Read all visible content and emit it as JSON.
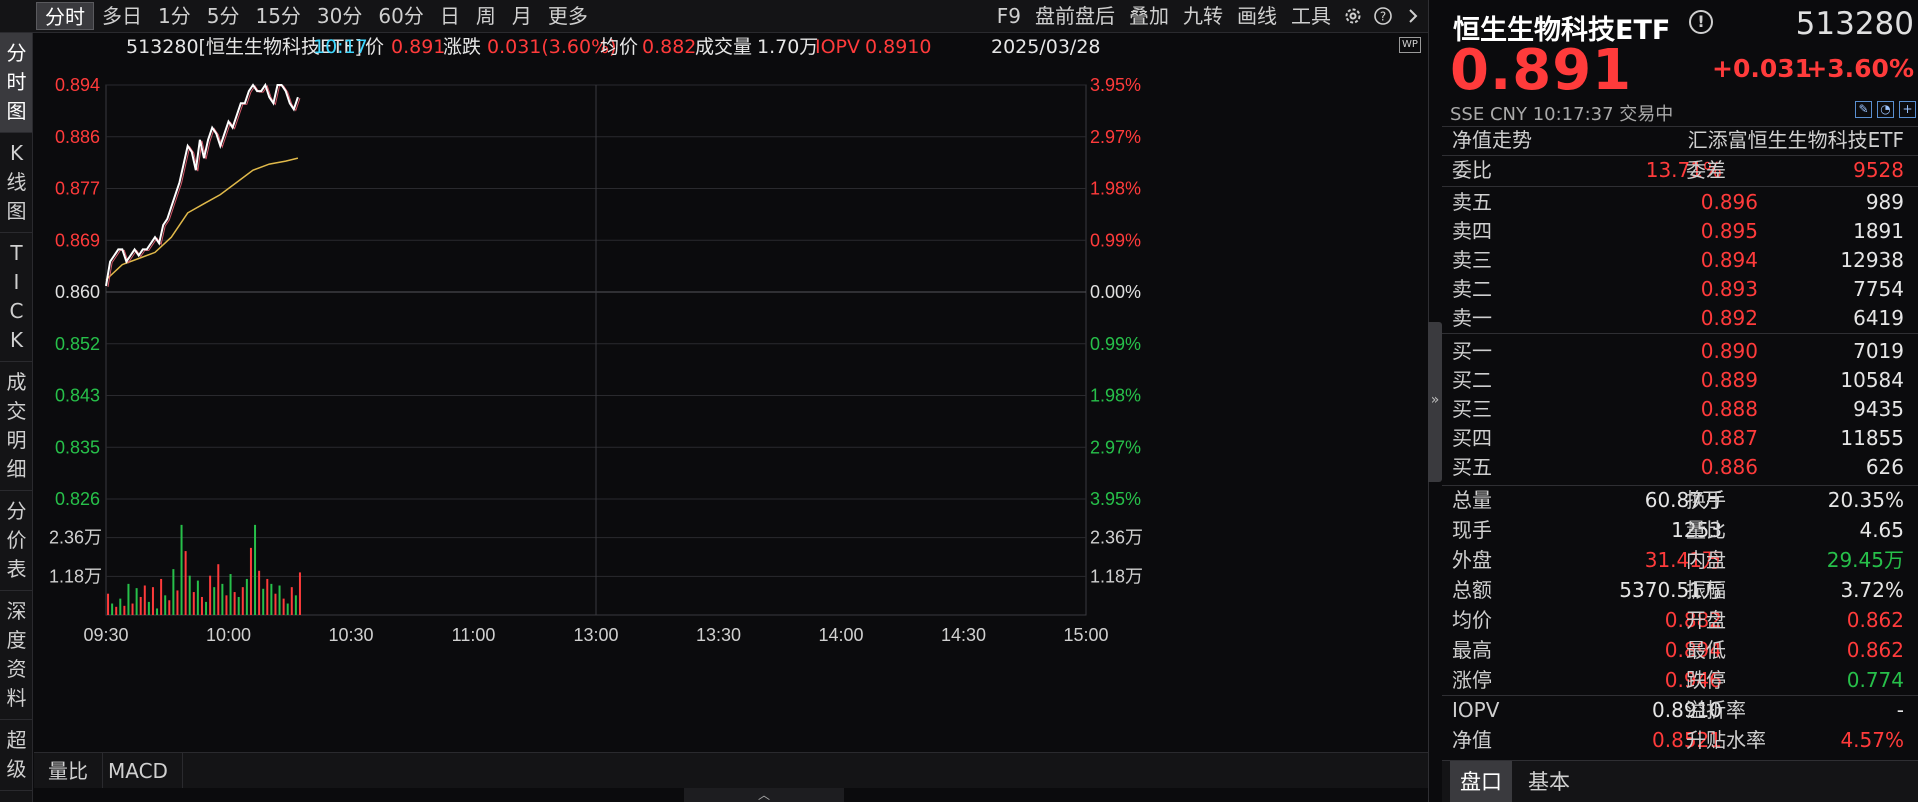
{
  "toolbar": {
    "periods": [
      "分时",
      "多日",
      "1分",
      "5分",
      "15分",
      "30分",
      "60分",
      "日",
      "周",
      "月",
      "更多"
    ],
    "tools": [
      "F9",
      "盘前盘后",
      "叠加",
      "九转",
      "画线",
      "工具"
    ],
    "icons": [
      "gear-icon",
      "help-icon",
      "chevron-right-icon"
    ]
  },
  "leftnav": [
    "分时图",
    "K线图",
    "TICK",
    "成交明细",
    "分价表",
    "深度资料",
    "超级"
  ],
  "chart": {
    "code_name": "513280[恒生生物科技ETF]",
    "time": "10:17",
    "price_label": "价",
    "price": "0.891",
    "change_label": "涨跌",
    "change": "0.031(3.60%)",
    "avg_label": "均价",
    "avg": "0.882",
    "volume_label": "成交量",
    "volume": "1.70万",
    "iopv_label": "IOPV",
    "iopv": "0.8910",
    "date": "2025/03/28",
    "wp_badge": "WP"
  },
  "chart_data": {
    "type": "line",
    "y_left_ticks": [
      "0.894",
      "0.886",
      "0.877",
      "0.869",
      "0.860",
      "0.852",
      "0.843",
      "0.835",
      "0.826"
    ],
    "y_right_ticks": [
      "3.95%",
      "2.97%",
      "1.98%",
      "0.99%",
      "0.00%",
      "0.99%",
      "1.98%",
      "2.97%",
      "3.95%"
    ],
    "x_ticks": [
      "09:30",
      "10:00",
      "10:30",
      "11:00",
      "13:00",
      "13:30",
      "14:00",
      "14:30",
      "15:00"
    ],
    "volume_ticks": [
      "2.36万",
      "1.18万"
    ],
    "ylim": [
      0.826,
      0.894
    ],
    "prev_close": 0.86,
    "colors": {
      "up": "#ff3b3b",
      "down": "#27c04a",
      "price_line": "#ffffff",
      "avg_line": "#e0b94a",
      "grid": "#2a2a2e"
    },
    "price_series": {
      "minutes": [
        0,
        1,
        2,
        3,
        4,
        5,
        6,
        7,
        8,
        9,
        10,
        11,
        12,
        13,
        14,
        15,
        16,
        17,
        18,
        19,
        20,
        21,
        22,
        23,
        24,
        25,
        26,
        27,
        28,
        29,
        30,
        31,
        32,
        33,
        34,
        35,
        36,
        37,
        38,
        39,
        40,
        41,
        42,
        43,
        44,
        45,
        46,
        47
      ],
      "values": [
        0.861,
        0.865,
        0.866,
        0.867,
        0.867,
        0.865,
        0.866,
        0.867,
        0.866,
        0.867,
        0.867,
        0.868,
        0.869,
        0.868,
        0.871,
        0.872,
        0.874,
        0.876,
        0.878,
        0.881,
        0.884,
        0.883,
        0.88,
        0.885,
        0.882,
        0.885,
        0.887,
        0.886,
        0.884,
        0.886,
        0.888,
        0.887,
        0.889,
        0.891,
        0.891,
        0.893,
        0.894,
        0.893,
        0.893,
        0.894,
        0.892,
        0.891,
        0.894,
        0.894,
        0.893,
        0.891,
        0.89,
        0.892
      ]
    },
    "avg_series": {
      "minutes": [
        0,
        4,
        8,
        12,
        16,
        20,
        24,
        28,
        32,
        36,
        40,
        44,
        47
      ],
      "values": [
        0.862,
        0.8645,
        0.8655,
        0.8665,
        0.869,
        0.873,
        0.8745,
        0.876,
        0.878,
        0.88,
        0.881,
        0.8815,
        0.882
      ]
    },
    "volume_series": {
      "unit": "万",
      "values": [
        0.65,
        0.35,
        0.25,
        0.5,
        0.28,
        0.95,
        0.35,
        0.82,
        0.55,
        0.9,
        0.4,
        0.85,
        0.2,
        1.1,
        0.6,
        0.45,
        1.4,
        0.75,
        2.75,
        1.95,
        1.2,
        0.7,
        1.05,
        0.55,
        0.4,
        1.2,
        0.85,
        1.55,
        0.95,
        0.6,
        1.25,
        0.7,
        0.55,
        0.85,
        1.1,
        2.05,
        2.75,
        1.35,
        0.8,
        1.1,
        0.95,
        0.65,
        0.9,
        0.5,
        0.35,
        0.85,
        0.6,
        1.3
      ],
      "up": [
        true,
        false,
        true,
        false,
        true,
        false,
        true,
        false,
        true,
        true,
        false,
        true,
        false,
        true,
        false,
        true,
        false,
        true,
        false,
        true,
        false,
        true,
        false,
        true,
        false,
        true,
        false,
        true,
        false,
        true,
        false,
        true,
        false,
        true,
        false,
        true,
        false,
        true,
        false,
        true,
        false,
        true,
        false,
        true,
        false,
        true,
        false,
        true
      ]
    }
  },
  "subtabs": [
    "量比",
    "MACD"
  ],
  "panel": {
    "name": "恒生生物科技ETF",
    "code": "513280",
    "price": "0.891",
    "change": "+0.031",
    "pct": "+3.60%",
    "status": "SSE  CNY  10:17:37  交易中",
    "nav_trend_label": "净值走势",
    "fund_name": "汇添富恒生生物科技ETF",
    "weibi_label": "委比",
    "weibi": "13.71%",
    "weicha_label": "委差",
    "weicha": "9528",
    "asks": [
      {
        "label": "卖五",
        "price": "0.896",
        "vol": "989"
      },
      {
        "label": "卖四",
        "price": "0.895",
        "vol": "1891"
      },
      {
        "label": "卖三",
        "price": "0.894",
        "vol": "12938"
      },
      {
        "label": "卖二",
        "price": "0.893",
        "vol": "7754"
      },
      {
        "label": "卖一",
        "price": "0.892",
        "vol": "6419"
      }
    ],
    "bids": [
      {
        "label": "买一",
        "price": "0.890",
        "vol": "7019"
      },
      {
        "label": "买二",
        "price": "0.889",
        "vol": "10584"
      },
      {
        "label": "买三",
        "price": "0.888",
        "vol": "9435"
      },
      {
        "label": "买四",
        "price": "0.887",
        "vol": "11855"
      },
      {
        "label": "买五",
        "price": "0.886",
        "vol": "626"
      }
    ],
    "stats": [
      {
        "l1": "总量",
        "v1": "60.87万",
        "c1": "white",
        "l2": "换手",
        "v2": "20.35%",
        "c2": "white"
      },
      {
        "l1": "现手",
        "v1": "1253",
        "c1": "white",
        "l2": "量比",
        "v2": "4.65",
        "c2": "white"
      },
      {
        "l1": "外盘",
        "v1": "31.41万",
        "c1": "red",
        "l2": "内盘",
        "v2": "29.45万",
        "c2": "green"
      },
      {
        "l1": "总额",
        "v1": "5370.51万",
        "c1": "white",
        "l2": "振幅",
        "v2": "3.72%",
        "c2": "white"
      },
      {
        "l1": "均价",
        "v1": "0.882",
        "c1": "red",
        "l2": "开盘",
        "v2": "0.862",
        "c2": "red"
      },
      {
        "l1": "最高",
        "v1": "0.894",
        "c1": "red",
        "l2": "最低",
        "v2": "0.862",
        "c2": "red"
      },
      {
        "l1": "涨停",
        "v1": "0.946",
        "c1": "red",
        "l2": "跌停",
        "v2": "0.774",
        "c2": "green"
      }
    ],
    "stats2": [
      {
        "l1": "IOPV",
        "v1": "0.8910",
        "c1": "white",
        "l2": "溢折率",
        "v2": "-",
        "c2": "white"
      },
      {
        "l1": "净值",
        "v1": "0.8521",
        "c1": "red",
        "l2": "升贴水率",
        "v2": "4.57%",
        "c2": "red"
      }
    ],
    "tabs": [
      "盘口",
      "基本"
    ]
  }
}
